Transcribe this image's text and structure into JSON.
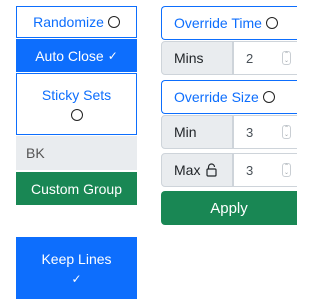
{
  "left": {
    "randomize_label": "Randomize",
    "auto_close_label": "Auto Close",
    "auto_close_check": "✓",
    "sticky_sets_label": "Sticky Sets",
    "bk_label": "BK",
    "custom_group_label": "Custom Group",
    "keep_lines_label": "Keep Lines",
    "keep_lines_check": "✓"
  },
  "right": {
    "override_time_label": "Override Time",
    "mins_label": "Mins",
    "mins_value": "2",
    "override_size_label": "Override Size",
    "min_label": "Min",
    "min_value": "3",
    "max_label": "Max",
    "max_value": "3",
    "apply_label": "Apply"
  },
  "colors": {
    "primary": "#0d6efd",
    "success": "#198754",
    "gray_bg": "#e9ecef"
  },
  "icons": {
    "radio": "radio-circle-icon",
    "check": "check-icon",
    "lock": "lock-icon",
    "spinner": "spinner-arrows-icon"
  }
}
